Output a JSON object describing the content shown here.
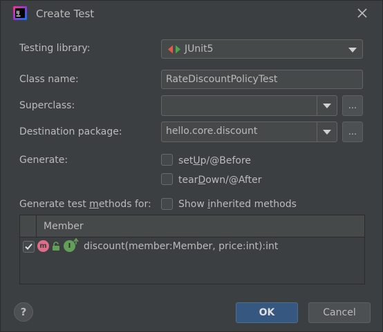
{
  "window": {
    "title": "Create Test",
    "app_icon": "intellij-idea-icon",
    "close_icon": "close-icon"
  },
  "form": {
    "testing_library_label": "Testing library:",
    "testing_library_value": "JUnit5",
    "class_name_label": "Class name:",
    "class_name_value": "RateDiscountPolicyTest",
    "superclass_label": "Superclass:",
    "superclass_value": "",
    "destination_label": "Destination package:",
    "destination_value": "hello.core.discount",
    "browse_label": "...",
    "generate_label": "Generate:",
    "setup_pre": "set",
    "setup_u": "U",
    "setup_post": "p/@Before",
    "teardown_pre": "tear",
    "teardown_u": "D",
    "teardown_post": "own/@After",
    "methods_label_pre": "Generate test ",
    "methods_label_u": "m",
    "methods_label_post": "ethods for:",
    "inherited_pre": "Show ",
    "inherited_u": "i",
    "inherited_post": "nherited methods"
  },
  "table": {
    "header": "Member",
    "rows": [
      {
        "checked": true,
        "icon_badge": "m",
        "text": "discount(member:Member, price:int):int"
      }
    ]
  },
  "buttons": {
    "help": "?",
    "ok": "OK",
    "cancel": "Cancel"
  },
  "colors": {
    "background": "#3c3f41",
    "accent": "#365880",
    "method_badge": "#e06c88",
    "interface_badge": "#62a05a"
  }
}
